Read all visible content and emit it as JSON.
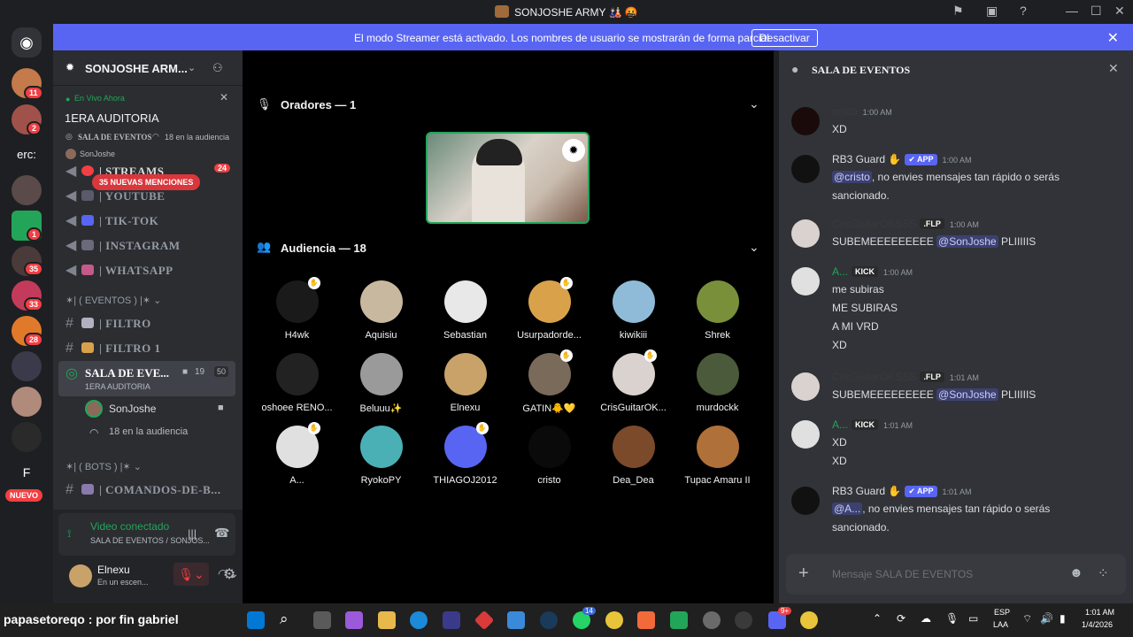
{
  "window": {
    "title": "SONJOSHE ARMY"
  },
  "banner": {
    "text": "El modo Streamer está activado. Los nombres de usuario se mostrarán de forma parcial.",
    "button": "Desactivar"
  },
  "guilds": {
    "badges": [
      "11",
      "2",
      "1",
      "35",
      "33",
      "28"
    ],
    "text_item": "erc:",
    "letter_item": "F",
    "new_label": "NUEVO"
  },
  "server": {
    "name": "SONJOSHE ARM...",
    "live": {
      "label": "En Vivo Ahora",
      "title": "1ERA AUDITORIA",
      "channel": "SALA DE EVENTOS",
      "audience": "18 en la audiencia",
      "host": "SonJoshe"
    },
    "mentions_pill": "35 NUEVAS MENCIONES",
    "channels_top": [
      "| STREAMS",
      "| YOUTUBE",
      "| TIK-TOK",
      "| INSTAGRAM",
      "| WHATSAPP"
    ],
    "streams_badge": "24",
    "cat_eventos": "✶| ( EVENTOS ) |✶",
    "eventos_channels": [
      "| FILTRO",
      "| FILTRO 1"
    ],
    "stage_channel": {
      "name": "SALA DE EVE...",
      "sub": "1ERA AUDITORIA",
      "video_count": "19",
      "limit": "50",
      "member": "SonJoshe",
      "audience": "18 en la audiencia"
    },
    "cat_bots": "✶| ( BOTS ) |✶",
    "bots_channels": [
      "| COMANDOS-DE-B..."
    ]
  },
  "voice": {
    "status": "Video conectado",
    "location": "SALA DE EVENTOS / SONJOS..."
  },
  "user": {
    "name": "Elnexu",
    "status": "En un escen..."
  },
  "stage": {
    "speakers_label": "Oradores — 1",
    "audience_label": "Audiencia — 18",
    "audience": [
      {
        "name": "H4wk",
        "color": "#1a1a1a",
        "hand": true
      },
      {
        "name": "Aquisiu",
        "color": "#c9b8a0",
        "hand": false
      },
      {
        "name": "Sebastian",
        "color": "#e8e8e8",
        "hand": false
      },
      {
        "name": "Usurpadorde...",
        "color": "#d9a24a",
        "hand": true
      },
      {
        "name": "kiwikiii",
        "color": "#8fbbd9",
        "hand": false
      },
      {
        "name": "Shrek",
        "color": "#7a8f3a",
        "hand": false
      },
      {
        "name": "oshoee RENO...",
        "color": "#222222",
        "hand": false
      },
      {
        "name": "Beluuu✨",
        "color": "#9a9a9a",
        "hand": false
      },
      {
        "name": "Elnexu",
        "color": "#c9a26a",
        "hand": false
      },
      {
        "name": "GATIN🐥💛",
        "color": "#7a6a5a",
        "hand": true
      },
      {
        "name": "CrisGuitarOK...",
        "color": "#d9d2cf",
        "hand": true
      },
      {
        "name": "murdockk",
        "color": "#4a5a3a",
        "hand": false
      },
      {
        "name": "A...",
        "color": "#e0e0e0",
        "hand": true
      },
      {
        "name": "RyokoPY",
        "color": "#4ab0b5",
        "hand": false
      },
      {
        "name": "THIAGOJ2012",
        "color": "#5865f2",
        "hand": true
      },
      {
        "name": "cristo",
        "color": "#0a0a0a",
        "hand": false
      },
      {
        "name": "Dea_Dea",
        "color": "#7a4a2a",
        "hand": false
      },
      {
        "name": "Tupac Amaru II",
        "color": "#b0703a",
        "hand": false
      }
    ]
  },
  "chat": {
    "title": "SALA DE EVENTOS",
    "placeholder": "Mensaje SALA DE EVENTOS",
    "messages": [
      {
        "author": "cristo",
        "author_color": "#3a3a3a",
        "time": "1:00 AM",
        "tag": "",
        "lines": [
          "XD"
        ],
        "av": "#1a0a0a"
      },
      {
        "author": "RB3 Guard ✋",
        "author_color": "#dbdee1",
        "time": "1:00 AM",
        "tag": "✔ APP",
        "tag_color": "#5865f2",
        "lines": [
          "@cristo, no envies mensajes tan rápido o serás",
          "sancionado."
        ],
        "av": "#111111"
      },
      {
        "author": "CrisGuitarOKSSS",
        "author_color": "#3a3a3a",
        "time": "1:00 AM",
        "tag": ".FLP",
        "tag_color": "#2a2a2a",
        "lines": [
          "SUBEMEEEEEEEEE @SonJoshe PLIIIIIS"
        ],
        "av": "#d9d2cf"
      },
      {
        "author": "A...",
        "author_color": "#23a559",
        "time": "1:00 AM",
        "tag": "KICK",
        "tag_color": "#2a2a2a",
        "lines": [
          "me subiras",
          "ME SUBIRAS",
          "A MI VRD",
          "XD"
        ],
        "av": "#e0e0e0"
      },
      {
        "author": "CrisGuitarOKSSS",
        "author_color": "#3a3a3a",
        "time": "1:01 AM",
        "tag": ".FLP",
        "tag_color": "#2a2a2a",
        "lines": [
          "SUBEMEEEEEEEEE @SonJoshe PLIIIIIS"
        ],
        "av": "#d9d2cf"
      },
      {
        "author": "A...",
        "author_color": "#23a559",
        "time": "1:01 AM",
        "tag": "KICK",
        "tag_color": "#2a2a2a",
        "lines": [
          "XD",
          "XD"
        ],
        "av": "#e0e0e0"
      },
      {
        "author": "RB3 Guard ✋",
        "author_color": "#dbdee1",
        "time": "1:01 AM",
        "tag": "✔ APP",
        "tag_color": "#5865f2",
        "lines": [
          "@A..., no envies mensajes tan rápido o serás",
          "sancionado."
        ],
        "av": "#111111"
      }
    ]
  },
  "taskbar": {
    "ticker": "papasetoreqo : por fin gabriel",
    "lang1": "ESP",
    "lang2": "LAA",
    "time": "1:01 AM",
    "date": "1/4/2026",
    "whatsapp_badge": "14",
    "discord_badge": "9+"
  }
}
